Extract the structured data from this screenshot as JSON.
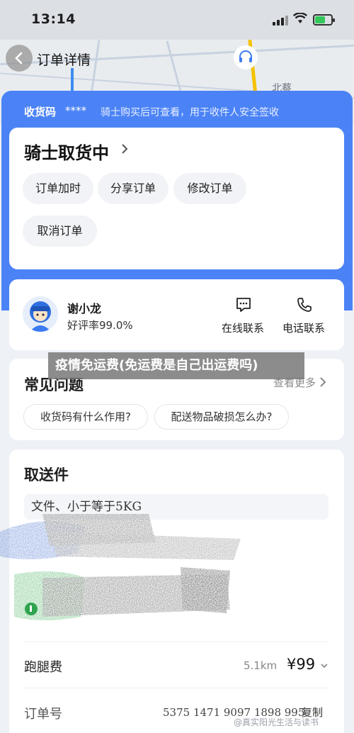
{
  "status_bar": {
    "time": "13:14"
  },
  "map": {
    "place": "北蔡"
  },
  "nav": {
    "title": "订单详情"
  },
  "pickup_code": {
    "label": "收货码",
    "value": "****",
    "desc": "骑士购买后可查看，用于收件人安全签收"
  },
  "order_status": {
    "title": "骑士取货中",
    "actions": [
      "订单加时",
      "分享订单",
      "修改订单",
      "取消订单"
    ]
  },
  "rider": {
    "name": "谢小龙",
    "rating": "好评率99.0%",
    "chat_label": "在线联系",
    "call_label": "电话联系"
  },
  "overlay_banner": "疫情免运费(免运费是自己出运费吗)",
  "faq": {
    "title": "常见问题",
    "more": "查看更多",
    "questions": [
      "收货码有什么作用?",
      "配送物品破损怎么办?"
    ]
  },
  "delivery": {
    "title": "取送件",
    "item": "文件、小于等于5KG",
    "fee_label": "跑腿费",
    "distance": "5.1km",
    "price": "¥99",
    "order_label": "订单号",
    "order_number": "5375 1471 9097 1898 995",
    "copy_label": "复制"
  },
  "watermark": "@真实阳光生活与读书",
  "colors": {
    "accent_blue": "#4b83f6",
    "map_yellow": "#f5c200",
    "battery_green": "#34c759"
  }
}
